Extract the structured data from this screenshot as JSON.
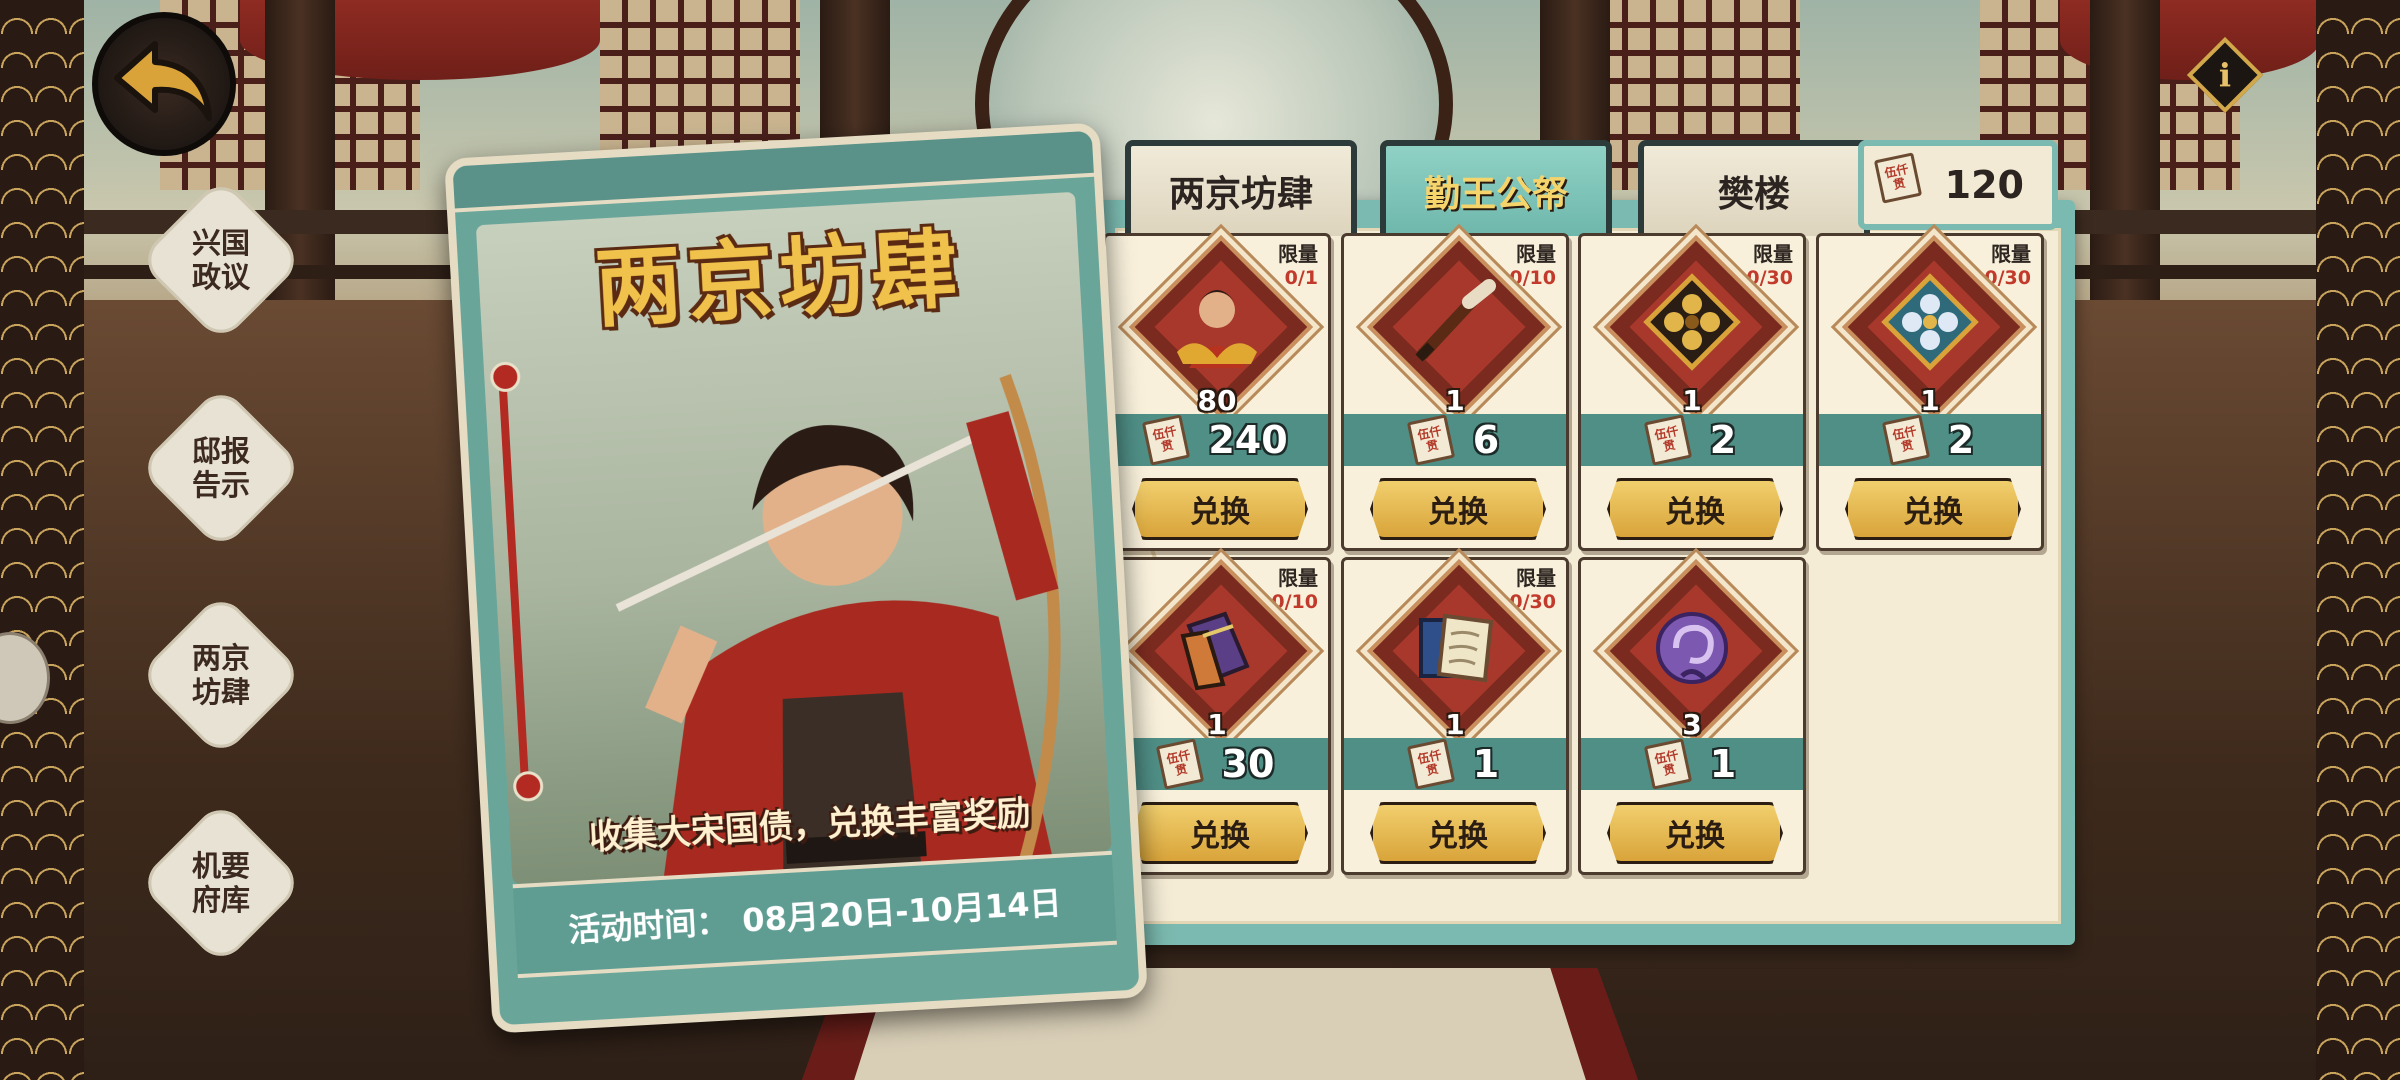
{
  "nav": {
    "back_icon": "back-arrow-icon",
    "info_label": "i",
    "side_items": [
      {
        "label": "兴国\n政议"
      },
      {
        "label": "邸报\n告示"
      },
      {
        "label": "两京\n坊肆"
      },
      {
        "label": "机要\n府库"
      }
    ]
  },
  "banner": {
    "title": "两京坊肆",
    "slogan": "收集大宋国债，兑换丰富奖励",
    "time_label": "活动时间：",
    "time_value": "08月20日-10月14日"
  },
  "tabs": [
    {
      "label": "两京坊肆",
      "active": false
    },
    {
      "label": "勤王公帑",
      "active": true
    },
    {
      "label": "樊楼",
      "active": false
    }
  ],
  "currency": {
    "icon": "ticket-icon",
    "ticket_text": "伍仟贯",
    "amount": "120"
  },
  "shop": {
    "limit_label": "限量",
    "button_label": "兑换",
    "ticket_text": "伍仟贯",
    "items": [
      {
        "icon": "hero-portrait-icon",
        "limit": "0/1",
        "qty": "80",
        "price": "240"
      },
      {
        "icon": "brush-icon",
        "limit": "0/10",
        "qty": "1",
        "price": "6"
      },
      {
        "icon": "gold-flower-token-icon",
        "limit": "0/30",
        "qty": "1",
        "price": "2"
      },
      {
        "icon": "blue-flower-token-icon",
        "limit": "0/30",
        "qty": "1",
        "price": "2"
      },
      {
        "icon": "book-icon",
        "limit": "0/10",
        "qty": "1",
        "price": "30"
      },
      {
        "icon": "scroll-icon",
        "limit": "0/30",
        "qty": "1",
        "price": "1"
      },
      {
        "icon": "purple-orb-icon",
        "limit": "",
        "qty": "3",
        "price": "1"
      }
    ]
  },
  "colors": {
    "accent": "#7bbab0",
    "gold": "#f1c24b",
    "limit_red": "#c23a2c",
    "button_gold": "#e0b04b"
  }
}
